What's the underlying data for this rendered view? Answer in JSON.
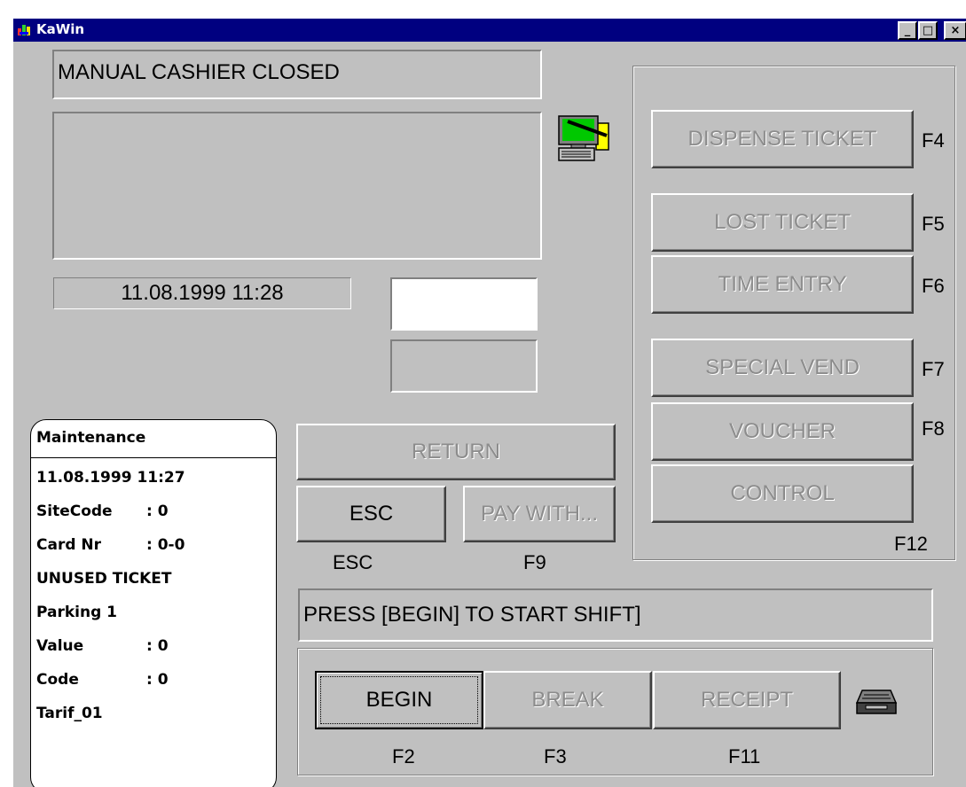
{
  "window": {
    "title": "KaWin"
  },
  "titlebar": {
    "minimize": "_",
    "maximize": "□",
    "close": "×"
  },
  "status": {
    "cashier": "MANUAL CASHIER CLOSED",
    "datetime": "11.08.1999 11:28",
    "prompt": "PRESS [BEGIN] TO START SHIFT]"
  },
  "buttons": {
    "dispense_ticket": {
      "label": "DISPENSE TICKET",
      "key": "F4"
    },
    "lost_ticket": {
      "label": "LOST TICKET",
      "key": "F5"
    },
    "time_entry": {
      "label": "TIME ENTRY",
      "key": "F6"
    },
    "special_vend": {
      "label": "SPECIAL VEND",
      "key": "F7"
    },
    "voucher": {
      "label": "VOUCHER",
      "key": "F8"
    },
    "control": {
      "label": "CONTROL",
      "key": "F12"
    },
    "return": {
      "label": "RETURN"
    },
    "esc": {
      "label": "ESC",
      "key": "ESC"
    },
    "pay_with": {
      "label": "PAY WITH...",
      "key": "F9"
    },
    "begin": {
      "label": "BEGIN",
      "key": "F2"
    },
    "break": {
      "label": "BREAK",
      "key": "F3"
    },
    "receipt": {
      "label": "RECEIPT",
      "key": "F11"
    }
  },
  "info_panel": {
    "header": "Maintenance",
    "datetime": "11.08.1999 11:27",
    "lines": [
      {
        "key": "SiteCode",
        "value": ": 0"
      },
      {
        "key": "Card Nr",
        "value": ": 0-0"
      },
      {
        "key": "UNUSED TICKET",
        "value": ""
      },
      {
        "key": "Parking 1",
        "value": ""
      },
      {
        "key": "Value",
        "value": ": 0"
      },
      {
        "key": "Code",
        "value": ": 0"
      },
      {
        "key": "Tarif_01",
        "value": ""
      }
    ]
  },
  "icons": {
    "terminal": "computer-terminal-icon",
    "printer": "receipt-printer-icon",
    "app": "kawin-app-icon"
  },
  "colors": {
    "titlebar": "#000080",
    "face": "#c0c0c0",
    "disabled_text": "#8c8c8c"
  }
}
